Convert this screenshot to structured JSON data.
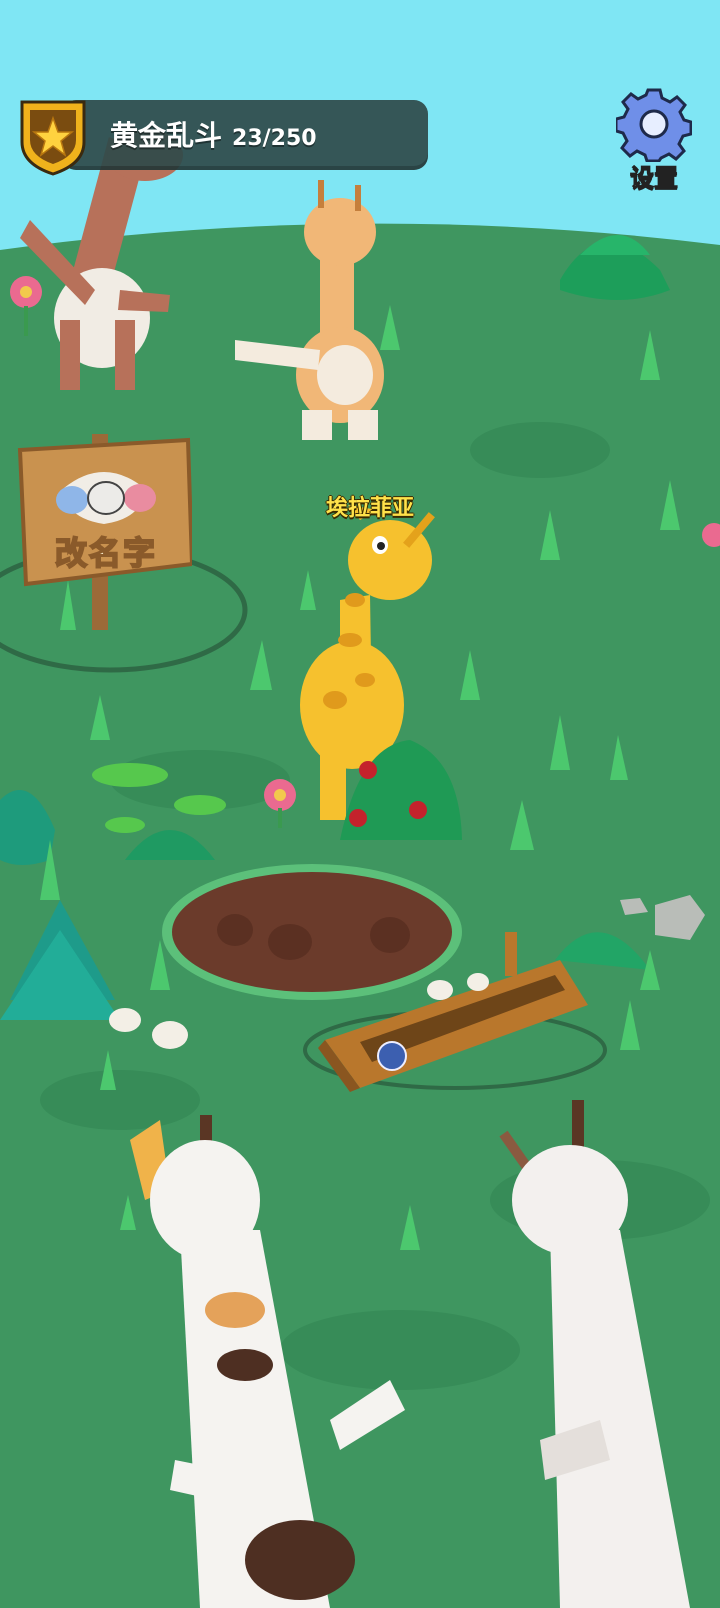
{
  "rank": {
    "title": "黄金乱斗",
    "progress": "23/250",
    "badge_icon": "star-shield-icon",
    "badge_color": "#f0b21c"
  },
  "settings": {
    "label": "设置",
    "icon": "gear-icon",
    "color": "#6f8fe8"
  },
  "player": {
    "name": "埃拉菲亚"
  },
  "sign": {
    "label": "改名字"
  },
  "colors": {
    "sky": "#7fe6f4",
    "grass": "#3f9660",
    "grass_dark": "#2f7f4f",
    "dirt": "#6b3b2b",
    "giraffe_yellow": "#f6c12e"
  }
}
